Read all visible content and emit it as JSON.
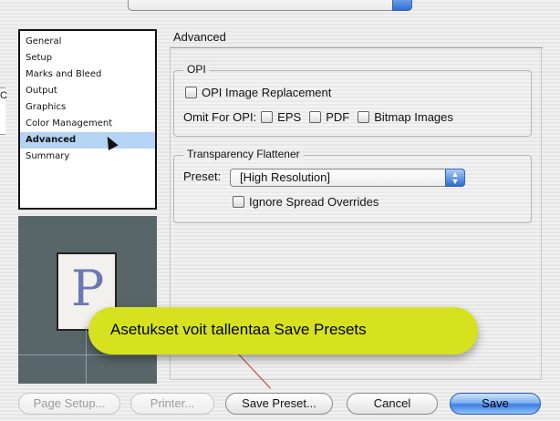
{
  "sidebar": {
    "items": [
      {
        "label": "General"
      },
      {
        "label": "Setup"
      },
      {
        "label": "Marks and Bleed"
      },
      {
        "label": "Output"
      },
      {
        "label": "Graphics"
      },
      {
        "label": "Color Management"
      },
      {
        "label": "Advanced",
        "selected": true
      },
      {
        "label": "Summary"
      }
    ]
  },
  "preview": {
    "page_letter": "P"
  },
  "left_sliver": {
    "text": "C"
  },
  "panel": {
    "title": "Advanced",
    "opi": {
      "group_label": "OPI",
      "image_replacement_label": "OPI Image Replacement",
      "omit_label": "Omit For OPI:",
      "omit_options": [
        "EPS",
        "PDF",
        "Bitmap Images"
      ]
    },
    "transparency": {
      "group_label": "Transparency Flattener",
      "preset_label": "Preset:",
      "preset_value": "[High Resolution]",
      "ignore_label": "Ignore Spread Overrides"
    }
  },
  "callout": {
    "text": "Asetukset voit tallentaa Save Presets"
  },
  "buttons": {
    "page_setup": "Page Setup...",
    "printer": "Printer...",
    "save_preset": "Save Preset...",
    "cancel": "Cancel",
    "save": "Save"
  },
  "colors": {
    "callout": "#d6e21f",
    "selection": "#b5d3f3",
    "preview_bg": "#58666a",
    "page_letter": "#6a78b4",
    "default_button": "#3c7fe4"
  }
}
